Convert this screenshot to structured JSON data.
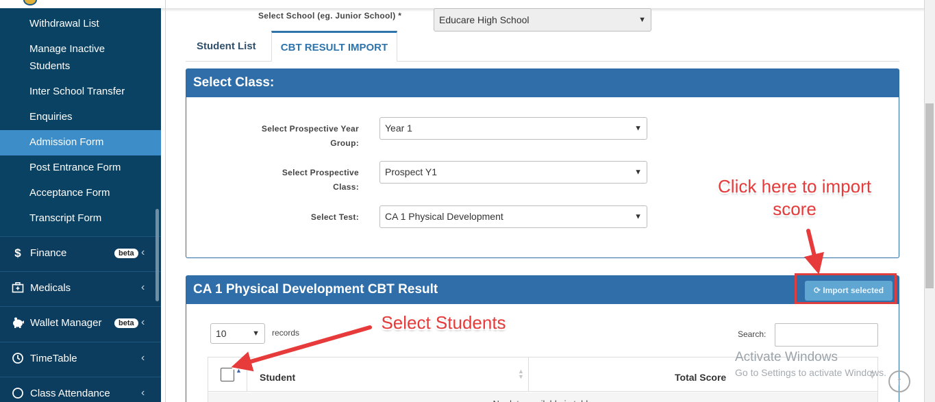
{
  "sidebar": {
    "sub_items": [
      {
        "label": "Withdrawal List"
      },
      {
        "label": "Manage Inactive Students"
      },
      {
        "label": "Inter School Transfer"
      },
      {
        "label": "Enquiries"
      },
      {
        "label": "Admission Form",
        "active": true
      },
      {
        "label": "Post Entrance Form"
      },
      {
        "label": "Acceptance Form"
      },
      {
        "label": "Transcript Form"
      }
    ],
    "menus": [
      {
        "label": "Finance",
        "icon": "dollar-icon",
        "badge": "beta"
      },
      {
        "label": "Medicals",
        "icon": "medkit-icon"
      },
      {
        "label": "Wallet Manager",
        "icon": "piggy-bank-icon",
        "badge": "beta"
      },
      {
        "label": "TimeTable",
        "icon": "clock-icon"
      },
      {
        "label": "Class Attendance",
        "icon": "check-circle-icon"
      }
    ]
  },
  "school": {
    "label": "Select School (eg. Junior School) *",
    "value": "Educare High School"
  },
  "tabs": [
    {
      "label": "Student List",
      "active": false
    },
    {
      "label": "CBT RESULT IMPORT",
      "active": true
    }
  ],
  "select_class": {
    "title": "Select Class:",
    "fields": [
      {
        "label": "Select Prospective Year Group:",
        "value": "Year 1"
      },
      {
        "label": "Select Prospective Class:",
        "value": "Prospect Y1"
      },
      {
        "label": "Select Test:",
        "value": "CA 1 Physical Development"
      }
    ]
  },
  "result_panel": {
    "title": "CA 1 Physical Development CBT Result",
    "import_button": "Import selected",
    "page_size": "10",
    "records_label": "records",
    "search_label": "Search:",
    "columns": [
      "Student",
      "Total Score"
    ],
    "empty_text": "No data available in table"
  },
  "annotations": {
    "import_hint": "Click here to import score",
    "select_hint": "Select Students"
  },
  "watermark": {
    "title": "Activate Windows",
    "subtitle": "Go to Settings to activate Windows."
  },
  "colors": {
    "sidebar_bg": "#0a4263",
    "sidebar_active": "#3c8dc8",
    "panel_header": "#2f6ea8",
    "annotation_red": "#e73a3a"
  }
}
